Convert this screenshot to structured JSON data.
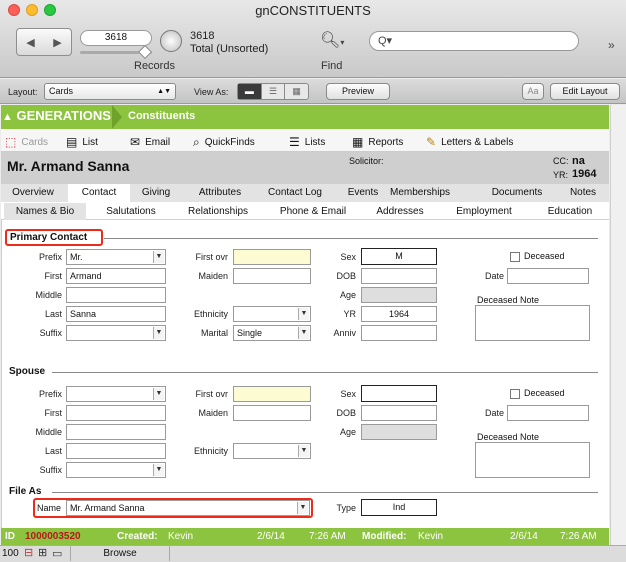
{
  "window": {
    "title": "gnCONSTITUENTS"
  },
  "toolbar": {
    "record_number": "3618",
    "total_count": "3618",
    "total_status": "Total (Unsorted)",
    "records_label": "Records",
    "find_label": "Find",
    "search_placeholder": "Q▾"
  },
  "layout_bar": {
    "layout_label": "Layout:",
    "layout_value": "Cards",
    "view_as_label": "View As:",
    "preview_label": "Preview",
    "text_size_icon": "Aa",
    "edit_layout_label": "Edit Layout"
  },
  "module": {
    "brand": "GENERATIONS",
    "title": "Constituents"
  },
  "nav": [
    {
      "label": "Cards",
      "icon": "cards-icon",
      "glyph": "⬚"
    },
    {
      "label": "List",
      "icon": "list-icon",
      "glyph": "▤"
    },
    {
      "label": "Email",
      "icon": "email-icon",
      "glyph": "✉"
    },
    {
      "label": "QuickFinds",
      "icon": "magnifier-icon",
      "glyph": "🔍"
    },
    {
      "label": "Lists",
      "icon": "lists-icon",
      "glyph": "☰"
    },
    {
      "label": "Reports",
      "icon": "reports-icon",
      "glyph": "▦"
    },
    {
      "label": "Letters & Labels",
      "icon": "letters-icon",
      "glyph": "✎"
    }
  ],
  "record_header": {
    "name": "Mr. Armand Sanna",
    "solicitor_label": "Solicitor:",
    "cc_label": "CC:",
    "cc_value": "na",
    "yr_label": "YR:",
    "yr_value": "1964"
  },
  "tabs_primary": [
    "Overview",
    "Contact",
    "Giving",
    "Attributes",
    "Contact Log",
    "Events",
    "Memberships",
    "Documents",
    "Notes"
  ],
  "tabs_secondary": [
    "Names & Bio",
    "Salutations",
    "Relationships",
    "Phone & Email",
    "Addresses",
    "Employment",
    "Education"
  ],
  "primary_contact": {
    "title": "Primary Contact",
    "prefix_label": "Prefix",
    "prefix_value": "Mr.",
    "first_label": "First",
    "first_value": "Armand",
    "middle_label": "Middle",
    "middle_value": "",
    "last_label": "Last",
    "last_value": "Sanna",
    "suffix_label": "Suffix",
    "suffix_value": "",
    "first_ovr_label": "First ovr",
    "first_ovr_value": "",
    "maiden_label": "Maiden",
    "maiden_value": "",
    "ethnicity_label": "Ethnicity",
    "ethnicity_value": "",
    "marital_label": "Marital",
    "marital_value": "Single",
    "sex_label": "Sex",
    "sex_value": "M",
    "dob_label": "DOB",
    "dob_value": "",
    "age_label": "Age",
    "age_value": "",
    "yr_label": "YR",
    "yr_value": "1964",
    "anniv_label": "Anniv",
    "anniv_value": "",
    "deceased_label": "Deceased",
    "date_label": "Date",
    "date_value": "",
    "deceased_note_label": "Deceased Note",
    "deceased_note_value": ""
  },
  "spouse": {
    "title": "Spouse",
    "prefix_label": "Prefix",
    "prefix_value": "",
    "first_label": "First",
    "first_value": "",
    "middle_label": "Middle",
    "middle_value": "",
    "last_label": "Last",
    "last_value": "",
    "suffix_label": "Suffix",
    "suffix_value": "",
    "first_ovr_label": "First ovr",
    "first_ovr_value": "",
    "maiden_label": "Maiden",
    "maiden_value": "",
    "ethnicity_label": "Ethnicity",
    "ethnicity_value": "",
    "sex_label": "Sex",
    "sex_value": "",
    "dob_label": "DOB",
    "dob_value": "",
    "age_label": "Age",
    "age_value": "",
    "deceased_label": "Deceased",
    "date_label": "Date",
    "date_value": "",
    "deceased_note_label": "Deceased Note",
    "deceased_note_value": ""
  },
  "file_as": {
    "title": "File As",
    "name_label": "Name",
    "name_value": "Mr. Armand Sanna",
    "type_label": "Type",
    "type_value": "Ind"
  },
  "footer": {
    "id_label": "ID",
    "id_value": "1000003520",
    "created_label": "Created:",
    "created_by": "Kevin",
    "created_date": "2/6/14",
    "created_time": "7:26 AM",
    "modified_label": "Modified:",
    "modified_by": "Kevin",
    "modified_date": "2/6/14",
    "modified_time": "7:26 AM"
  },
  "statusbar": {
    "zoom": "100",
    "mode": "Browse"
  },
  "colors": {
    "brand_green": "#8dc43f",
    "highlight_red": "#ee2a1b",
    "id_red": "#b8161e"
  }
}
